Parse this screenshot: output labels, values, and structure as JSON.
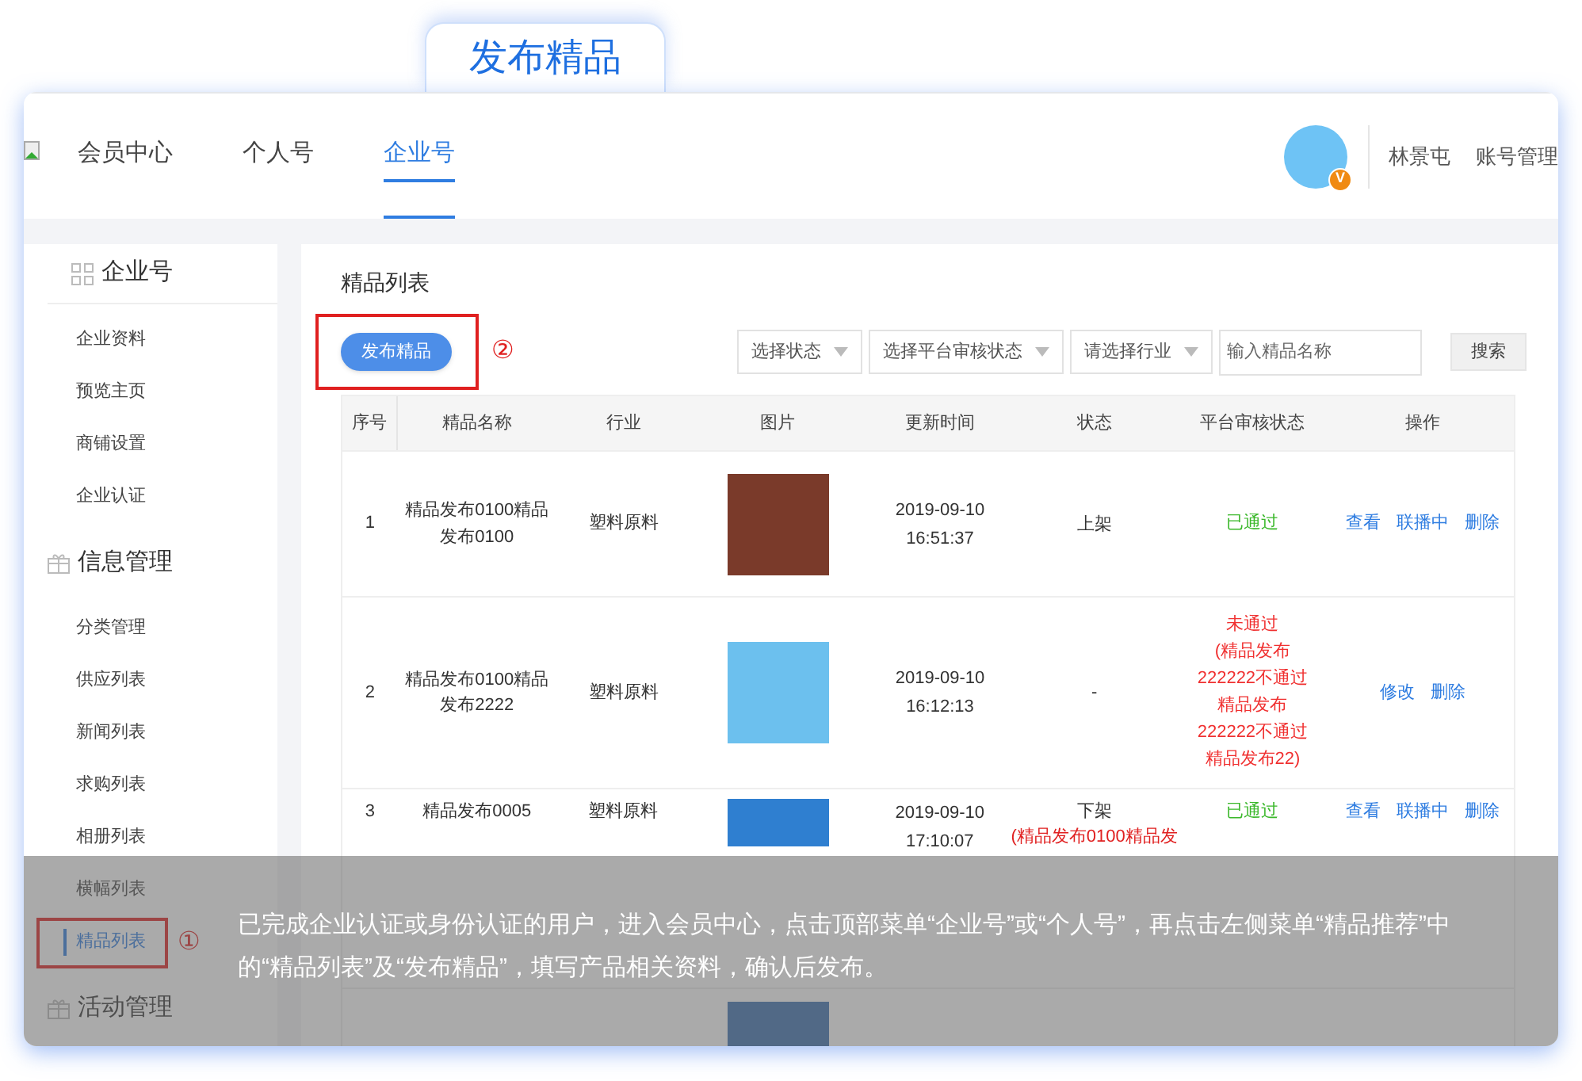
{
  "page_title": "发布精品",
  "nav": {
    "items": [
      {
        "label": "会员中心",
        "selected": false
      },
      {
        "label": "个人号",
        "selected": false
      },
      {
        "label": "企业号",
        "selected": true
      }
    ],
    "avatar_badge": "V",
    "user_name": "林景屯",
    "account_link": "账号管理"
  },
  "sidebar": {
    "groups": [
      {
        "title": "企业号",
        "items": [
          {
            "label": "企业资料",
            "selected": false
          },
          {
            "label": "预览主页",
            "selected": false
          },
          {
            "label": "商铺设置",
            "selected": false
          },
          {
            "label": "企业认证",
            "selected": false
          }
        ]
      },
      {
        "title": "信息管理",
        "items": [
          {
            "label": "分类管理",
            "selected": false
          },
          {
            "label": "供应列表",
            "selected": false
          },
          {
            "label": "新闻列表",
            "selected": false
          },
          {
            "label": "求购列表",
            "selected": false
          },
          {
            "label": "相册列表",
            "selected": false
          },
          {
            "label": "横幅列表",
            "selected": false
          },
          {
            "label": "精品列表",
            "selected": true,
            "marker": "①"
          }
        ]
      },
      {
        "title": "活动管理"
      }
    ]
  },
  "content": {
    "title": "精品列表",
    "publish_button": "发布精品",
    "publish_marker": "②",
    "filters": [
      {
        "kind": "select",
        "label": "选择状态"
      },
      {
        "kind": "select",
        "label": "选择平台审核状态"
      },
      {
        "kind": "select",
        "label": "请选择行业"
      },
      {
        "kind": "input",
        "placeholder": "输入精品名称"
      }
    ],
    "search_button": "搜索",
    "table": {
      "columns": [
        "序号",
        "精品名称",
        "行业",
        "图片",
        "更新时间",
        "状态",
        "平台审核状态",
        "操作"
      ],
      "rows": [
        {
          "index": "1",
          "name": "精品发布0100精品发布0100",
          "industry": "塑料原料",
          "date": "2019-09-10",
          "time": "16:51:37",
          "status": "上架",
          "status_note": "",
          "audit": {
            "kind": "passed",
            "lines": [
              "已通过"
            ]
          },
          "actions": [
            "查看",
            "联播中",
            "删除"
          ]
        },
        {
          "index": "2",
          "name": "精品发布0100精品发布2222",
          "industry": "塑料原料",
          "date": "2019-09-10",
          "time": "16:12:13",
          "status": "-",
          "status_note": "",
          "audit": {
            "kind": "failed",
            "lines": [
              "未通过",
              "(精品发布",
              "222222不通过",
              "精品发布",
              "222222不通过",
              "精品发布22)"
            ]
          },
          "actions": [
            "修改",
            "删除"
          ]
        },
        {
          "index": "3",
          "name": "精品发布0005",
          "industry": "塑料原料",
          "date": "2019-09-10",
          "time": "17:10:07",
          "status": "下架",
          "status_note": "(精品发布0100精品发",
          "audit": {
            "kind": "passed",
            "lines": [
              "已通过"
            ]
          },
          "actions": [
            "查看",
            "联播中",
            "删除"
          ]
        }
      ]
    }
  },
  "caption": "已完成企业认证或身份认证的用户，进入会员中心，点击顶部菜单“企业号”或“个人号”，再点击左侧菜单“精品推荐”中的“精品列表”及“发布精品”，填写产品相关资料，确认后发布。"
}
